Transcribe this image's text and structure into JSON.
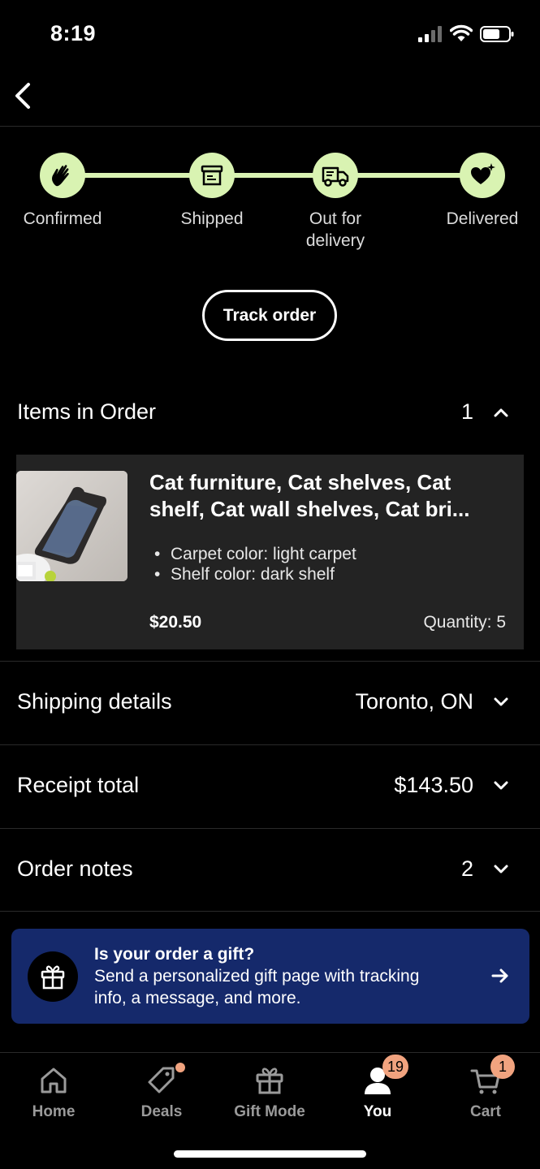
{
  "status_bar": {
    "time": "8:19"
  },
  "tracker": {
    "steps": [
      {
        "label": "Confirmed",
        "icon": "waving-hand-icon"
      },
      {
        "label": "Shipped",
        "icon": "box-icon"
      },
      {
        "label": "Out for\ndelivery",
        "icon": "delivery-truck-icon"
      },
      {
        "label": "Delivered",
        "icon": "heart-sparkle-icon"
      }
    ],
    "track_button": "Track order"
  },
  "items_section": {
    "title": "Items in Order",
    "count": "1",
    "item": {
      "title": "Cat furniture, Cat shelves, Cat shelf, Cat wall shelves, Cat bri...",
      "variations": [
        "Carpet color: light carpet",
        "Shelf color: dark shelf"
      ],
      "price": "$20.50",
      "quantity": "Quantity: 5"
    }
  },
  "shipping": {
    "title": "Shipping details",
    "value": "Toronto, ON"
  },
  "receipt": {
    "title": "Receipt total",
    "value": "$143.50"
  },
  "notes": {
    "title": "Order notes",
    "value": "2"
  },
  "gift_banner": {
    "title": "Is your order a gift?",
    "text": "Send a personalized gift page with tracking info, a message, and more."
  },
  "bottom_nav": {
    "items": [
      {
        "label": "Home",
        "icon": "home-icon"
      },
      {
        "label": "Deals",
        "icon": "tag-icon"
      },
      {
        "label": "Gift Mode",
        "icon": "gift-icon"
      },
      {
        "label": "You",
        "icon": "user-icon",
        "badge": "19"
      },
      {
        "label": "Cart",
        "icon": "cart-icon",
        "badge": "1"
      }
    ],
    "active": "You"
  },
  "colors": {
    "accent_green": "#d9f3b2",
    "banner_blue": "#15296b",
    "badge": "#f1a37f",
    "card": "#232323"
  }
}
